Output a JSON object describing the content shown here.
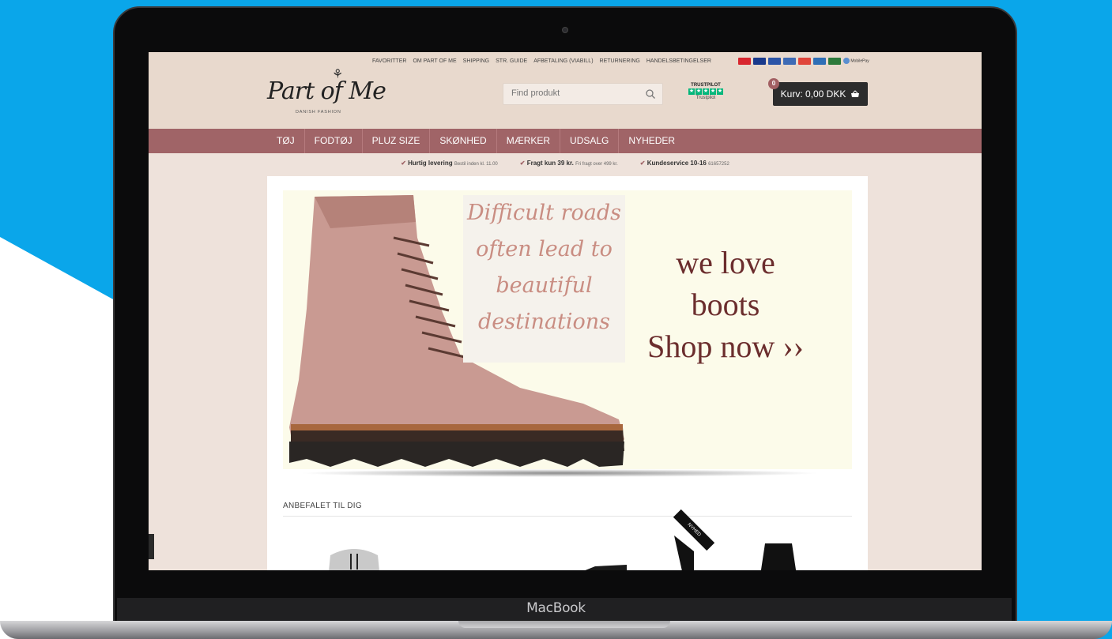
{
  "device": {
    "label": "MacBook"
  },
  "toplinks": [
    "FAVORITTER",
    "OM PART OF ME",
    "SHIPPING",
    "STR. GUIDE",
    "AFBETALING (VIABILL)",
    "RETURNERING",
    "HANDELSBETINGELSER"
  ],
  "payment_icons": [
    {
      "name": "dankort-icon",
      "color": "#d8262e"
    },
    {
      "name": "visa-icon",
      "color": "#1a3a8c"
    },
    {
      "name": "visa-electron-icon",
      "color": "#2c55a8"
    },
    {
      "name": "maestro-icon",
      "color": "#3e6bb5"
    },
    {
      "name": "mastercard-icon",
      "color": "#e0453a"
    },
    {
      "name": "amex-icon",
      "color": "#2f6fb6"
    },
    {
      "name": "jcb-icon",
      "color": "#2d7a3b"
    },
    {
      "name": "mobilepay-icon",
      "color": "#5a8fd0"
    }
  ],
  "mobilepay_label": "MobilePay",
  "logo": {
    "text": "Part of Me",
    "sub": "DANISH FASHION"
  },
  "search": {
    "placeholder": "Find produkt"
  },
  "trustpilot": {
    "title": "TRUSTPILOT",
    "label": "Trustpilot",
    "stars": 5
  },
  "cart": {
    "count": "0",
    "label": "Kurv: 0,00 DKK"
  },
  "nav": [
    "TØJ",
    "FODTØJ",
    "PLUZ SIZE",
    "SKØNHED",
    "MÆRKER",
    "UDSALG",
    "NYHEDER"
  ],
  "usp": [
    {
      "title": "Hurtig levering",
      "sub": "Bestil inden kl. 11.00"
    },
    {
      "title": "Fragt kun 39 kr.",
      "sub": "Fri fragt over 499 kr."
    },
    {
      "title": "Kundeservice 10-16",
      "sub": "61657252"
    }
  ],
  "banner": {
    "quote_lines": [
      "Difficult roads",
      "often lead to",
      "beautiful",
      "destinations"
    ],
    "cta_lines": [
      "we love",
      "boots",
      "Shop now ››"
    ]
  },
  "section": {
    "title": "ANBEFALET TIL DIG"
  },
  "badge": {
    "new": "NYHED"
  },
  "colors": {
    "brand": "#a06467",
    "topbar": "#e8d9cd",
    "page": "#eee2db",
    "text_dark": "#6b2d2d"
  }
}
